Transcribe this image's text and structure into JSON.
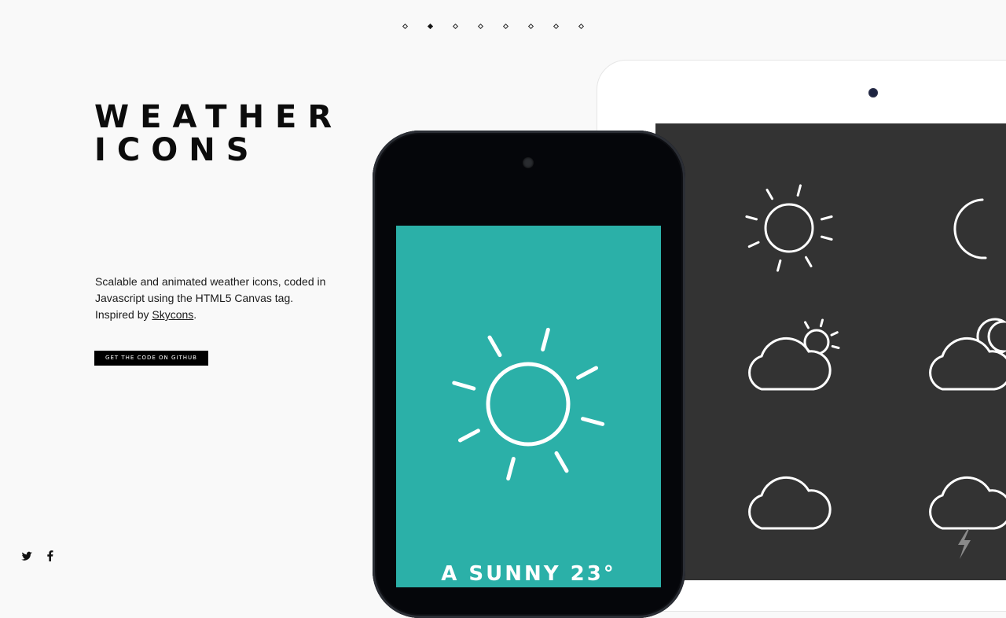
{
  "pagination": {
    "count": 8,
    "active_index": 1
  },
  "hero": {
    "title_line1": "WEATHER",
    "title_line2": "ICONS",
    "description_before": "Scalable and animated weather icons, coded in Javascript using the HTML5 Canvas tag. Inspired by ",
    "description_link": "Skycons",
    "description_after": ".",
    "button_label": "GET THE CODE ON GITHUB"
  },
  "social": {
    "icons": [
      "twitter-icon",
      "facebook-icon"
    ]
  },
  "phone": {
    "caption": "A SUNNY 23°",
    "screen_color": "#2bb0a8",
    "icon": "clear-day-icon"
  },
  "tablet": {
    "screen_color": "#333333",
    "icons": [
      "clear-day-icon",
      "clear-night-icon",
      "partly-cloudy-day-icon",
      "partly-cloudy-night-icon",
      "cloudy-icon",
      "thunderstorm-icon"
    ]
  }
}
